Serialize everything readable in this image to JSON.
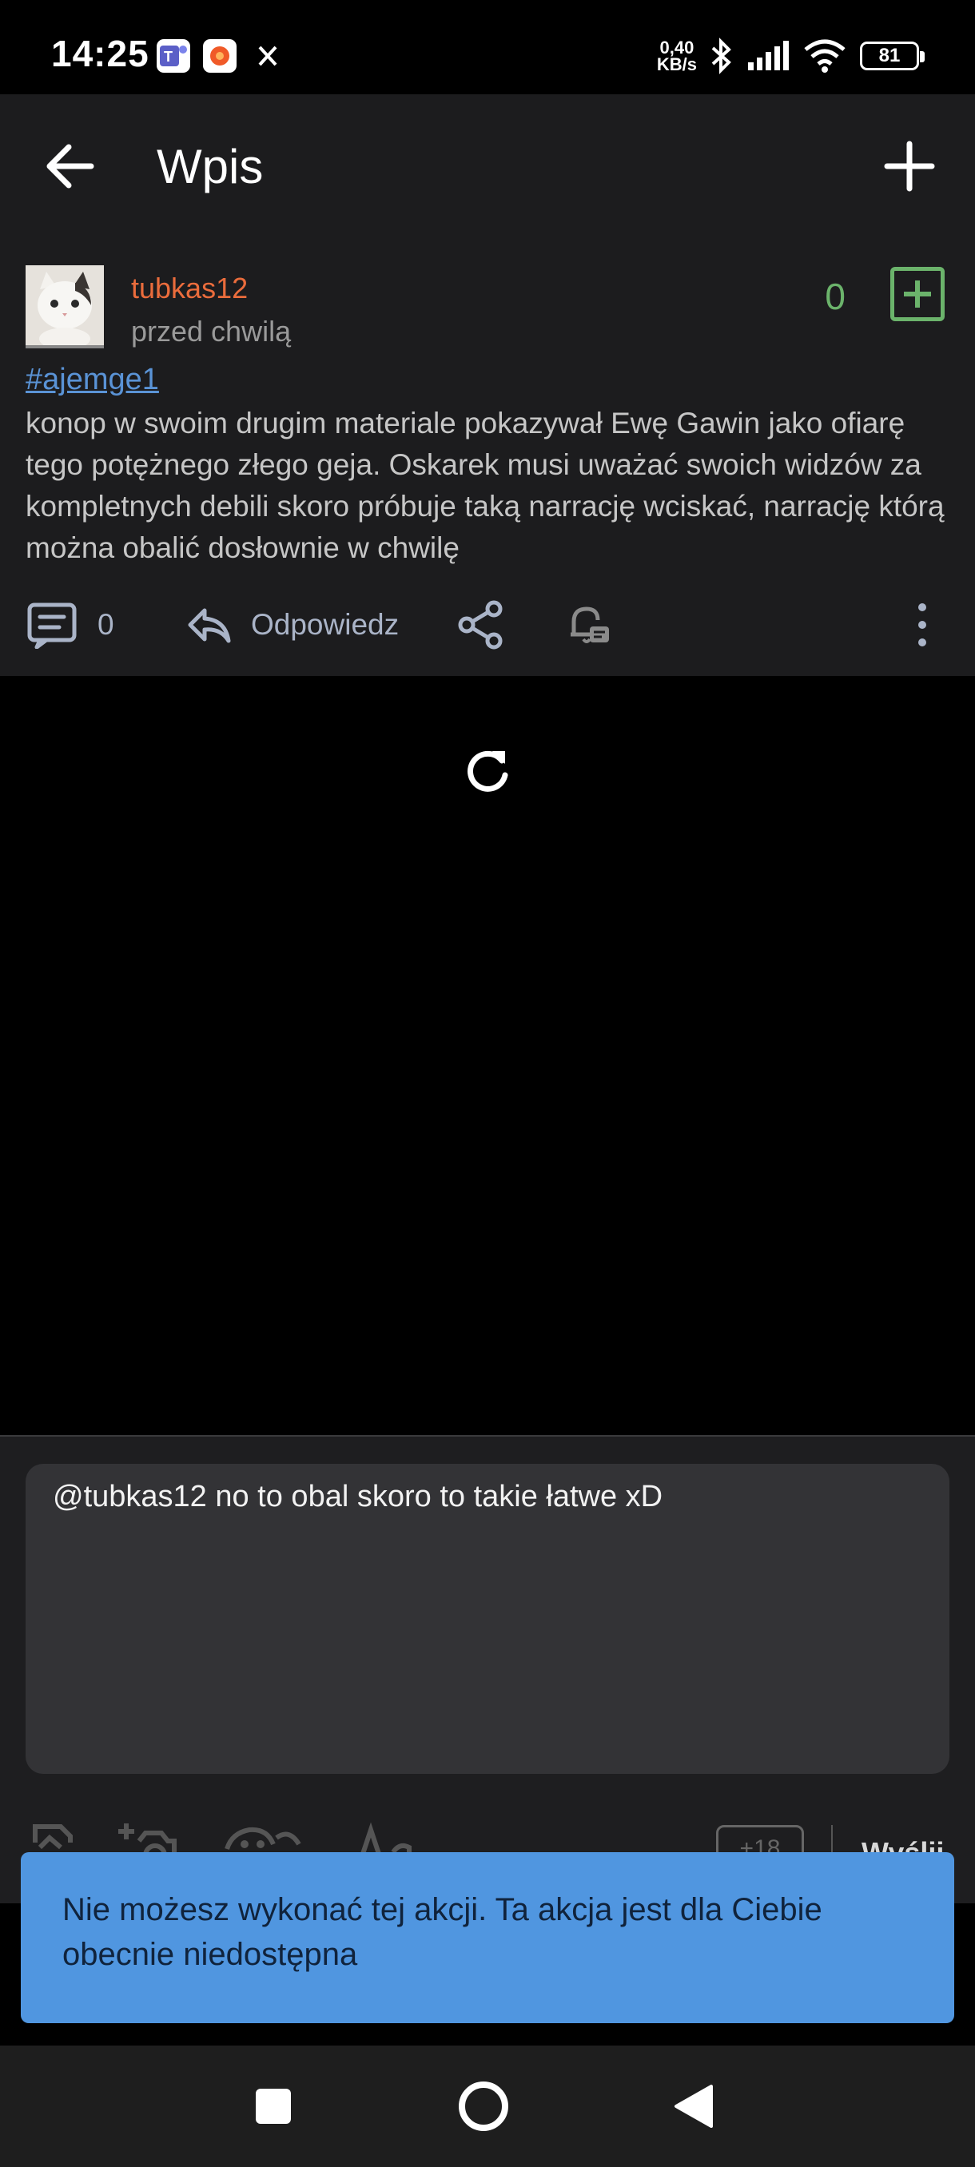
{
  "status_bar": {
    "time": "14:25",
    "net_speed_value": "0,40",
    "net_speed_unit": "KB/s",
    "battery": "81",
    "notification_icons": [
      "teams-icon",
      "orange-app-icon",
      "x-icon"
    ]
  },
  "app_bar": {
    "title": "Wpis"
  },
  "post": {
    "username": "tubkas12",
    "time": "przed chwilą",
    "votes": "0",
    "tag": "#ajemge1",
    "body": "konop w swoim drugim materiale pokazywał Ewę Gawin jako ofiarę tego potężnego złego geja. Oskarek musi uważać swoich widzów za kompletnych debili skoro próbuje taką narrację wciskać, narrację którą można obalić dosłownie w chwilę",
    "comments_count": "0",
    "reply_label": "Odpowiedz"
  },
  "composer": {
    "value": "@tubkas12 no to obal skoro to takie łatwe xD",
    "adult_label": "+18",
    "send_label": "Wyślij"
  },
  "toast": {
    "message": "Nie możesz wykonać tej akcji. Ta akcja jest dla Ciebie obecnie niedostępna"
  },
  "colors": {
    "username": "#ea6c3c",
    "vote_green": "#6bb36b",
    "tag_blue": "#5a93d6",
    "toast_bg": "#5096e0"
  }
}
